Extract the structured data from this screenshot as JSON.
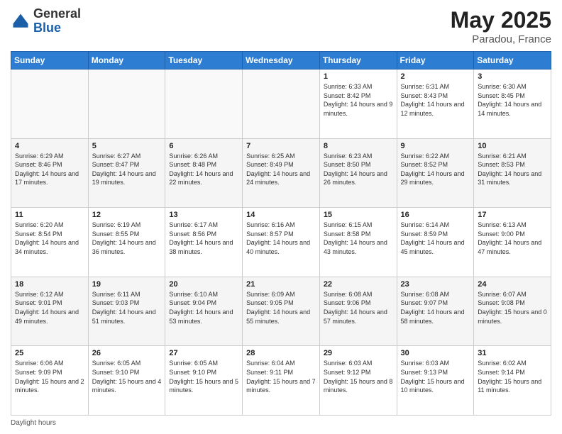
{
  "header": {
    "logo_general": "General",
    "logo_blue": "Blue",
    "month_title": "May 2025",
    "location": "Paradou, France"
  },
  "footer": {
    "daylight_label": "Daylight hours"
  },
  "days_of_week": [
    "Sunday",
    "Monday",
    "Tuesday",
    "Wednesday",
    "Thursday",
    "Friday",
    "Saturday"
  ],
  "weeks": [
    [
      {
        "day": "",
        "info": ""
      },
      {
        "day": "",
        "info": ""
      },
      {
        "day": "",
        "info": ""
      },
      {
        "day": "",
        "info": ""
      },
      {
        "day": "1",
        "info": "Sunrise: 6:33 AM\nSunset: 8:42 PM\nDaylight: 14 hours\nand 9 minutes."
      },
      {
        "day": "2",
        "info": "Sunrise: 6:31 AM\nSunset: 8:43 PM\nDaylight: 14 hours\nand 12 minutes."
      },
      {
        "day": "3",
        "info": "Sunrise: 6:30 AM\nSunset: 8:45 PM\nDaylight: 14 hours\nand 14 minutes."
      }
    ],
    [
      {
        "day": "4",
        "info": "Sunrise: 6:29 AM\nSunset: 8:46 PM\nDaylight: 14 hours\nand 17 minutes."
      },
      {
        "day": "5",
        "info": "Sunrise: 6:27 AM\nSunset: 8:47 PM\nDaylight: 14 hours\nand 19 minutes."
      },
      {
        "day": "6",
        "info": "Sunrise: 6:26 AM\nSunset: 8:48 PM\nDaylight: 14 hours\nand 22 minutes."
      },
      {
        "day": "7",
        "info": "Sunrise: 6:25 AM\nSunset: 8:49 PM\nDaylight: 14 hours\nand 24 minutes."
      },
      {
        "day": "8",
        "info": "Sunrise: 6:23 AM\nSunset: 8:50 PM\nDaylight: 14 hours\nand 26 minutes."
      },
      {
        "day": "9",
        "info": "Sunrise: 6:22 AM\nSunset: 8:52 PM\nDaylight: 14 hours\nand 29 minutes."
      },
      {
        "day": "10",
        "info": "Sunrise: 6:21 AM\nSunset: 8:53 PM\nDaylight: 14 hours\nand 31 minutes."
      }
    ],
    [
      {
        "day": "11",
        "info": "Sunrise: 6:20 AM\nSunset: 8:54 PM\nDaylight: 14 hours\nand 34 minutes."
      },
      {
        "day": "12",
        "info": "Sunrise: 6:19 AM\nSunset: 8:55 PM\nDaylight: 14 hours\nand 36 minutes."
      },
      {
        "day": "13",
        "info": "Sunrise: 6:17 AM\nSunset: 8:56 PM\nDaylight: 14 hours\nand 38 minutes."
      },
      {
        "day": "14",
        "info": "Sunrise: 6:16 AM\nSunset: 8:57 PM\nDaylight: 14 hours\nand 40 minutes."
      },
      {
        "day": "15",
        "info": "Sunrise: 6:15 AM\nSunset: 8:58 PM\nDaylight: 14 hours\nand 43 minutes."
      },
      {
        "day": "16",
        "info": "Sunrise: 6:14 AM\nSunset: 8:59 PM\nDaylight: 14 hours\nand 45 minutes."
      },
      {
        "day": "17",
        "info": "Sunrise: 6:13 AM\nSunset: 9:00 PM\nDaylight: 14 hours\nand 47 minutes."
      }
    ],
    [
      {
        "day": "18",
        "info": "Sunrise: 6:12 AM\nSunset: 9:01 PM\nDaylight: 14 hours\nand 49 minutes."
      },
      {
        "day": "19",
        "info": "Sunrise: 6:11 AM\nSunset: 9:03 PM\nDaylight: 14 hours\nand 51 minutes."
      },
      {
        "day": "20",
        "info": "Sunrise: 6:10 AM\nSunset: 9:04 PM\nDaylight: 14 hours\nand 53 minutes."
      },
      {
        "day": "21",
        "info": "Sunrise: 6:09 AM\nSunset: 9:05 PM\nDaylight: 14 hours\nand 55 minutes."
      },
      {
        "day": "22",
        "info": "Sunrise: 6:08 AM\nSunset: 9:06 PM\nDaylight: 14 hours\nand 57 minutes."
      },
      {
        "day": "23",
        "info": "Sunrise: 6:08 AM\nSunset: 9:07 PM\nDaylight: 14 hours\nand 58 minutes."
      },
      {
        "day": "24",
        "info": "Sunrise: 6:07 AM\nSunset: 9:08 PM\nDaylight: 15 hours\nand 0 minutes."
      }
    ],
    [
      {
        "day": "25",
        "info": "Sunrise: 6:06 AM\nSunset: 9:09 PM\nDaylight: 15 hours\nand 2 minutes."
      },
      {
        "day": "26",
        "info": "Sunrise: 6:05 AM\nSunset: 9:10 PM\nDaylight: 15 hours\nand 4 minutes."
      },
      {
        "day": "27",
        "info": "Sunrise: 6:05 AM\nSunset: 9:10 PM\nDaylight: 15 hours\nand 5 minutes."
      },
      {
        "day": "28",
        "info": "Sunrise: 6:04 AM\nSunset: 9:11 PM\nDaylight: 15 hours\nand 7 minutes."
      },
      {
        "day": "29",
        "info": "Sunrise: 6:03 AM\nSunset: 9:12 PM\nDaylight: 15 hours\nand 8 minutes."
      },
      {
        "day": "30",
        "info": "Sunrise: 6:03 AM\nSunset: 9:13 PM\nDaylight: 15 hours\nand 10 minutes."
      },
      {
        "day": "31",
        "info": "Sunrise: 6:02 AM\nSunset: 9:14 PM\nDaylight: 15 hours\nand 11 minutes."
      }
    ]
  ]
}
